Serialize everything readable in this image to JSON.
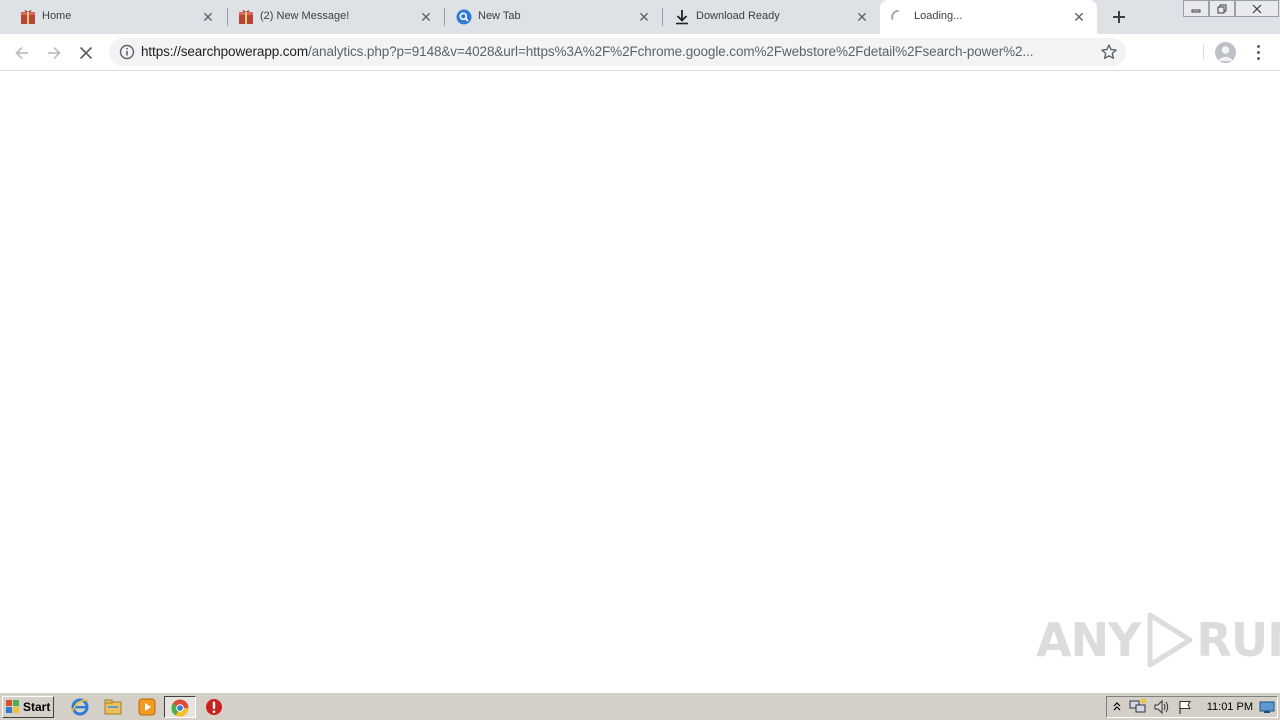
{
  "tabs": [
    {
      "label": "Home",
      "icon": "gift-box-icon"
    },
    {
      "label": "(2) New Message!",
      "icon": "gift-box-icon"
    },
    {
      "label": "New Tab",
      "icon": "search-circle-icon"
    },
    {
      "label": "Download Ready",
      "icon": "download-arrow-icon"
    },
    {
      "label": "Loading...",
      "icon": "loading-spinner-icon"
    }
  ],
  "window_controls": {
    "minimize": "minimize-icon",
    "restore": "restore-icon",
    "close": "close-icon"
  },
  "address_bar": {
    "url_host": "https://searchpowerapp.com",
    "url_path": "/analytics.php?p=9148&v=4028&url=https%3A%2F%2Fchrome.google.com%2Fwebstore%2Fdetail%2Fsearch-power%2..."
  },
  "watermark": {
    "left": "ANY",
    "right": "RUN"
  },
  "taskbar": {
    "start_label": "Start",
    "clock": "11:01 PM"
  },
  "colors": {
    "tabstrip": "#dee1e6",
    "active_tab": "#ffffff",
    "omnibox": "#f1f3f4",
    "taskbar": "#d4d0c8"
  }
}
